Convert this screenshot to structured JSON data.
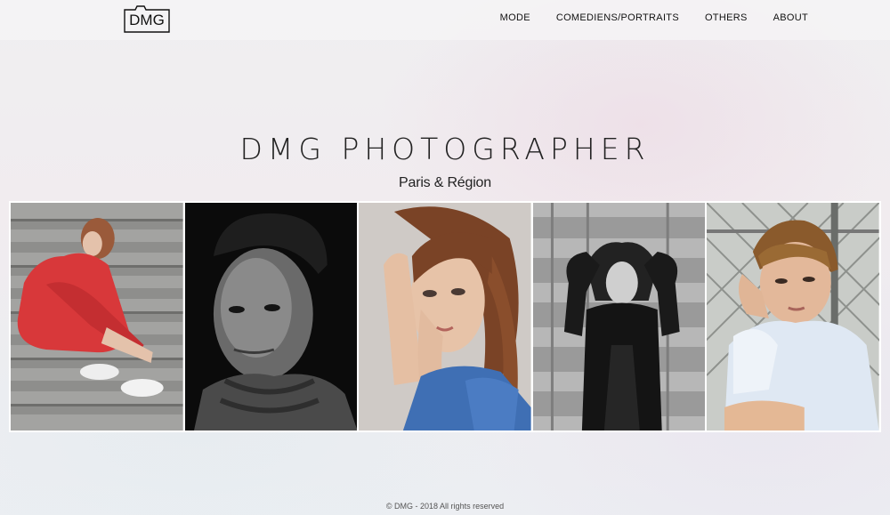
{
  "brand": {
    "logo_text": "DMG"
  },
  "nav": {
    "items": [
      {
        "label": "MODE"
      },
      {
        "label": "COMEDIENS/PORTRAITS"
      },
      {
        "label": "OTHERS"
      },
      {
        "label": "ABOUT"
      }
    ]
  },
  "hero": {
    "title": "DMG PHOTOGRAPHER",
    "subtitle": "Paris & Région"
  },
  "gallery": {
    "photos": [
      {
        "subject": "woman in red jumpsuit sitting on stairs"
      },
      {
        "subject": "black and white portrait of young man in turtleneck"
      },
      {
        "subject": "woman with hands near face in blue top"
      },
      {
        "subject": "black and white woman with arms raised"
      },
      {
        "subject": "young man in light blue shirt by fence"
      }
    ]
  },
  "footer": {
    "copyright": "© DMG - 2018 All rights reserved"
  },
  "colors": {
    "text": "#1a1a1a",
    "header_bg": "#f6f4f6",
    "gallery_frame": "#ffffff"
  }
}
